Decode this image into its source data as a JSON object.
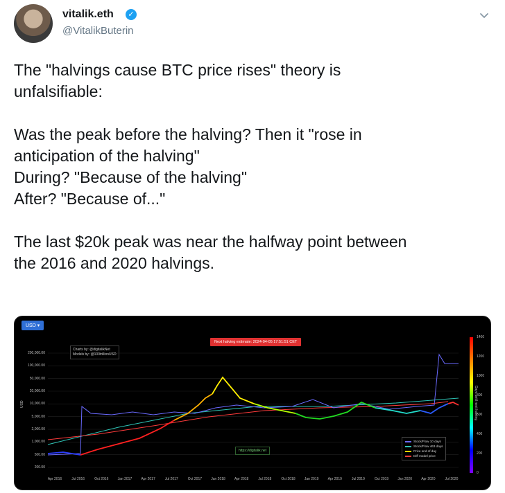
{
  "tweet": {
    "author_name": "vitalik.eth",
    "verified_mark": "✓",
    "handle": "@VitalikButerin",
    "lines": [
      "The \"halvings cause BTC price rises\" theory is",
      "unfalsifiable:",
      "",
      "Was the peak before the halving? Then it \"rose in",
      "anticipation of the halving\"",
      "During? \"Because of the halving\"",
      "After? \"Because of...\"",
      "",
      "The last $20k peak was near the halfway point between",
      "the 2016 and 2020 halvings."
    ]
  },
  "icons": {
    "avatar": "avatar-photo",
    "verified": "verified-badge-icon",
    "menu": "chevron-down-icon"
  },
  "chart_image": {
    "currency_button": "USD ▾",
    "notice": "Next halving estimate: 2024-04-05 17:51:51 CET",
    "credits": [
      "Charts by: @digitalikNet",
      "Models by: @100trillionUSD"
    ],
    "link": "https://digitalik.net",
    "y_ticks": [
      "200,000.00",
      "100,000.00",
      "50,000.00",
      "20,000.00",
      "10,000.00",
      "5,000.00",
      "2,000.00",
      "1,000.00",
      "500.00",
      "200.00"
    ],
    "y_axis_title": "USD",
    "x_ticks": [
      "Apr 2016",
      "Jul 2016",
      "Oct 2016",
      "Jan 2017",
      "Apr 2017",
      "Jul 2017",
      "Oct 2017",
      "Jan 2018",
      "Apr 2018",
      "Jul 2018",
      "Oct 2018",
      "Jan 2019",
      "Apr 2019",
      "Jul 2019",
      "Oct 2019",
      "Jan 2020",
      "Apr 2020",
      "Jul 2020"
    ],
    "colorbar_ticks": [
      "1400",
      "1200",
      "1000",
      "800",
      "600",
      "400",
      "200",
      "0"
    ],
    "colorbar_title": "Days until next halving",
    "legend": [
      {
        "label": "Stock/Flow 10 days",
        "color": "#6a6aff"
      },
      {
        "label": "Stock/Flow 463 days",
        "color": "#2ec4b6"
      },
      {
        "label": "Price end of day",
        "color": "#ffd400"
      },
      {
        "label": "Diff model price",
        "color": "#ff3b3b"
      }
    ],
    "colors": {
      "background": "#000000",
      "grid": "#222222",
      "sf10": "#6a6aff",
      "sf463": "#2ec4b6",
      "diff": "#ff3b3b"
    }
  }
}
